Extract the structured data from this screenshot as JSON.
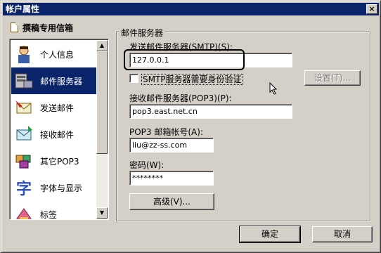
{
  "window": {
    "title": "帐户属性",
    "close_glyph": "×"
  },
  "account": {
    "name": "撰稿专用信箱"
  },
  "sidebar": {
    "items": [
      {
        "label": "个人信息",
        "icon": "person-icon",
        "selected": false
      },
      {
        "label": "邮件服务器",
        "icon": "server-icon",
        "selected": true
      },
      {
        "label": "发送邮件",
        "icon": "send-mail-icon",
        "selected": false
      },
      {
        "label": "接收邮件",
        "icon": "receive-mail-icon",
        "selected": false
      },
      {
        "label": "其它POP3",
        "icon": "pop3-icon",
        "selected": false
      },
      {
        "label": "字体与显示",
        "icon": "font-icon",
        "selected": false
      },
      {
        "label": "标签",
        "icon": "tag-icon",
        "selected": false
      }
    ],
    "scroll_up_glyph": "▲",
    "scroll_down_glyph": "▼"
  },
  "mail_server": {
    "group_title": "邮件服务器",
    "smtp_label": "发送邮件服务器(SMTP)(S):",
    "smtp_value": "127.0.0.1",
    "smtp_auth_label": "SMTP服务器需要身份验证",
    "smtp_auth_checked": false,
    "settings_button": "设置(T)...",
    "pop3_server_label": "接收邮件服务器(POP3)(P):",
    "pop3_server_value": "pop3.east.net.cn",
    "pop3_account_label": "POP3 邮箱帐号(A):",
    "pop3_account_value": "liu@zz-ss.com",
    "password_label": "密码(W):",
    "password_value": "********",
    "advanced_button": "高级(V)..."
  },
  "footer": {
    "ok_button": "确定",
    "cancel_button": "取消"
  },
  "colors": {
    "titlebar": "#0a246a",
    "selection": "#0a246a",
    "face": "#d4d0c8"
  }
}
